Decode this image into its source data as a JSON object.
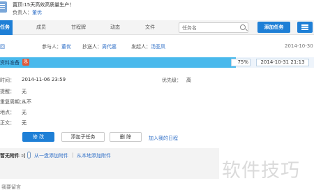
{
  "header": {
    "task_title": "置顶:15天高效高质量生产！",
    "owner_label": "负责人：",
    "owner_name": "董优"
  },
  "tabs": [
    {
      "label": "任务",
      "active": true
    },
    {
      "label": "成员",
      "active": false
    },
    {
      "label": "甘程牌",
      "active": false
    },
    {
      "label": "动态",
      "active": false
    },
    {
      "label": "文件",
      "active": false
    }
  ],
  "search": {
    "placeholder": "任务名"
  },
  "add_task_label": "添加任务",
  "info": {
    "back_label": "回",
    "participants_label": "参与人：",
    "participants": "董优",
    "cc_label": "抄送人：",
    "cc": "周代嘉",
    "sender_label": "发起人：",
    "sender": "汤亚凤",
    "date": "2014-10-30"
  },
  "progress": {
    "label": "资料准备",
    "badge": "急",
    "percent": 75,
    "percent_text": "75%",
    "due": "2014-10-31 21:13",
    "fill_color": "#49b9ec"
  },
  "details": [
    {
      "label": "时间：",
      "value": "2014-11-06 23:59"
    },
    {
      "label": "提醒：",
      "value": "无"
    },
    {
      "label": "重复周期：",
      "value": "从不"
    },
    {
      "label": "地点：",
      "value": "无"
    },
    {
      "label": "正文：",
      "value": "无"
    }
  ],
  "priority": {
    "label": "优先级：",
    "value": "高"
  },
  "actions": {
    "edit": "修 改",
    "add_subtask": "添加子任务",
    "delete": "删 除",
    "join": "加入我的日程"
  },
  "attachments": {
    "none_label": "暂无附件 :(",
    "from_cloud": "从一盘添加附件",
    "from_local": "从本地添加附件",
    "separator": "|"
  },
  "watermark": "软件技巧",
  "comment_label": "我要留言",
  "colors": {
    "accent": "#1e7fd6",
    "link": "#2f6fc7",
    "urgent": "#e15a3a"
  }
}
